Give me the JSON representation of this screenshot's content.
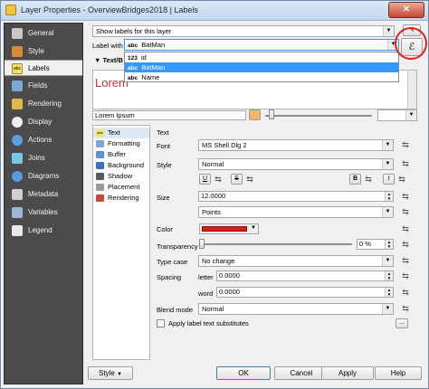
{
  "window": {
    "title": "Layer Properties - OverviewBridges2018 | Labels",
    "close_label": "✕"
  },
  "sidebar": {
    "items": [
      {
        "label": "General",
        "icon": "wrench-icon",
        "color": "#c9c9c9"
      },
      {
        "label": "Style",
        "icon": "brush-icon",
        "color": "#d88a3a"
      },
      {
        "label": "Labels",
        "icon": "abc-label-icon",
        "color": "#f2e36a"
      },
      {
        "label": "Fields",
        "icon": "table-icon",
        "color": "#7aa7d8"
      },
      {
        "label": "Rendering",
        "icon": "paintbrush-icon",
        "color": "#e0b84a"
      },
      {
        "label": "Display",
        "icon": "speech-bubble-icon",
        "color": "#f1f1f1"
      },
      {
        "label": "Actions",
        "icon": "gear-icon",
        "color": "#5fa0dc"
      },
      {
        "label": "Joins",
        "icon": "join-icon",
        "color": "#79c8e8"
      },
      {
        "label": "Diagrams",
        "icon": "pie-chart-icon",
        "color": "#5a9ad8"
      },
      {
        "label": "Metadata",
        "icon": "info-icon",
        "color": "#d0d0d0"
      },
      {
        "label": "Variables",
        "icon": "variables-icon",
        "color": "#9bb7d6"
      },
      {
        "label": "Legend",
        "icon": "legend-icon",
        "color": "#e9e9e9"
      }
    ],
    "active_index": 2
  },
  "labels": {
    "mode_value": "Show labels for this layer",
    "label_with_caption": "Label with",
    "label_with_value": "BatMan",
    "label_with_tag": "abc",
    "expression_button": "ℰ",
    "dropdown_items": [
      {
        "tag": "123",
        "label": "id"
      },
      {
        "tag": "abc",
        "label": "BatMan"
      },
      {
        "tag": "abc",
        "label": "Name"
      }
    ],
    "dropdown_selected_index": 1,
    "section_title": "Text/B",
    "preview_text": "Lorem",
    "lorem_field": "Lorem Ipsum"
  },
  "subtabs": [
    {
      "label": "Text",
      "tag": "abc",
      "color": "#f2e36a"
    },
    {
      "label": "Formatting",
      "tag": "",
      "color": "#7aa7d8"
    },
    {
      "label": "Buffer",
      "tag": "",
      "color": "#5f8fd8"
    },
    {
      "label": "Background",
      "tag": "",
      "color": "#3a6fc8"
    },
    {
      "label": "Shadow",
      "tag": "",
      "color": "#5a5a5a"
    },
    {
      "label": "Placement",
      "tag": "",
      "color": "#9a9a9a"
    },
    {
      "label": "Rendering",
      "tag": "",
      "color": "#c84a3a"
    }
  ],
  "text_panel": {
    "heading": "Text",
    "font_label": "Font",
    "font_value": "MS Shell Dlg 2",
    "style_label": "Style",
    "style_value": "Normal",
    "fmt_underline": "U",
    "fmt_strike": "S",
    "fmt_bold": "B",
    "fmt_italic": "I",
    "size_label": "Size",
    "size_value": "12.0000",
    "size_unit": "Points",
    "color_label": "Color",
    "text_color": "#e01a1a",
    "transparency_label": "Transparency",
    "transparency_value": "0 %",
    "type_case_label": "Type case",
    "type_case_value": "No change",
    "spacing_label": "Spacing",
    "letter_label": "letter",
    "letter_value": "0.0000",
    "word_label": "word",
    "word_value": "0.0000",
    "blend_label": "Blend mode",
    "blend_value": "Normal",
    "substitutes_label": "Apply label text substitutes",
    "ellipsis": "..."
  },
  "footer": {
    "style_button": "Style",
    "ok": "OK",
    "cancel": "Cancel",
    "apply": "Apply",
    "help": "Help"
  }
}
